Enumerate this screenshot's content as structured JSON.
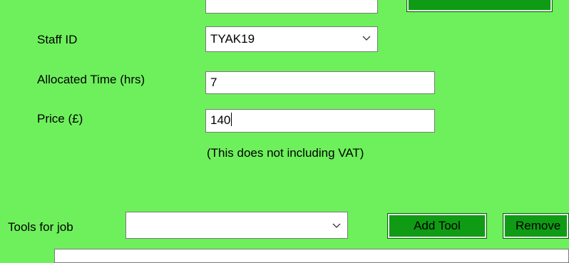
{
  "staff": {
    "label": "Staff ID",
    "value": "TYAK19"
  },
  "allocated_time": {
    "label": "Allocated Time (hrs)",
    "value": "7"
  },
  "price": {
    "label": "Price (£)",
    "value": "140",
    "note": "(This does not including VAT)"
  },
  "tools": {
    "label": "Tools for job",
    "selected": "",
    "add_label": "Add Tool",
    "remove_label": "Remove"
  }
}
